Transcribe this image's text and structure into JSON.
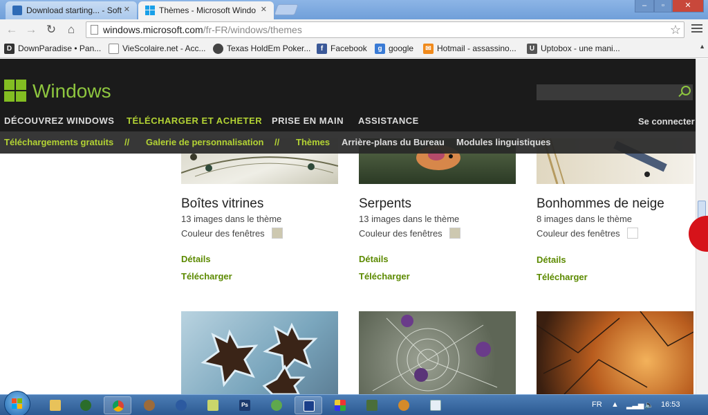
{
  "browser": {
    "tabs": [
      {
        "title": "Download starting... - Soft",
        "icon": "softonic-icon",
        "active": false
      },
      {
        "title": "Thèmes - Microsoft Windo",
        "icon": "windows-icon",
        "active": true
      }
    ],
    "close_glyph": "✕",
    "url_host": "windows.microsoft.com",
    "url_path": "/fr-FR/windows/themes",
    "bookmarks": [
      {
        "label": "DownParadise • Pan...",
        "icon": "downparadise-icon"
      },
      {
        "label": "VieScolaire.net - Acc...",
        "icon": "page-icon"
      },
      {
        "label": "Texas HoldEm Poker...",
        "icon": "poker-icon"
      },
      {
        "label": "Facebook",
        "icon": "facebook-icon"
      },
      {
        "label": "google",
        "icon": "google-icon"
      },
      {
        "label": "Hotmail - assassino...",
        "icon": "hotmail-icon"
      },
      {
        "label": "Uptobox - une mani...",
        "icon": "uptobox-icon"
      }
    ]
  },
  "site": {
    "logo_text": "Windows",
    "search_placeholder": "",
    "main_nav": [
      "DÉCOUVREZ WINDOWS",
      "TÉLÉCHARGER ET ACHETER",
      "PRISE EN MAIN",
      "ASSISTANCE"
    ],
    "sign_in": "Se connecter",
    "sub_nav": [
      "Téléchargements gratuits",
      "//",
      "Galerie de personnalisation",
      "//",
      "Thèmes",
      "Arrière-plans du Bureau",
      "Modules linguistiques"
    ]
  },
  "themes": [
    {
      "title": "Boîtes vitrines",
      "count": "13 images dans le thème",
      "color_label": "Couleur des fenêtres",
      "color": "#cdc8b0",
      "details": "Détails",
      "download": "Télécharger"
    },
    {
      "title": "Serpents",
      "count": "13 images dans le thème",
      "color_label": "Couleur des fenêtres",
      "color": "#cdc8b0",
      "details": "Détails",
      "download": "Télécharger"
    },
    {
      "title": "Bonhommes de neige",
      "count": "8 images dans le thème",
      "color_label": "Couleur des fenêtres",
      "color": "#ffffff",
      "details": "Détails",
      "download": "Télécharger"
    }
  ],
  "taskbar": {
    "apps": [
      "explorer-icon",
      "media-icon",
      "chrome-icon",
      "paint-icon",
      "cyberlink-icon",
      "notepad-icon",
      "photoshop-icon",
      "messenger-icon",
      "screen-capture-icon",
      "picasa-icon",
      "network-icon",
      "spinner-icon",
      "document-icon"
    ],
    "photoshop_label": "Ps",
    "language": "FR",
    "clock": "16:53"
  },
  "colors": {
    "accent_green": "#8ec63f",
    "link_green": "#5c8a00"
  }
}
